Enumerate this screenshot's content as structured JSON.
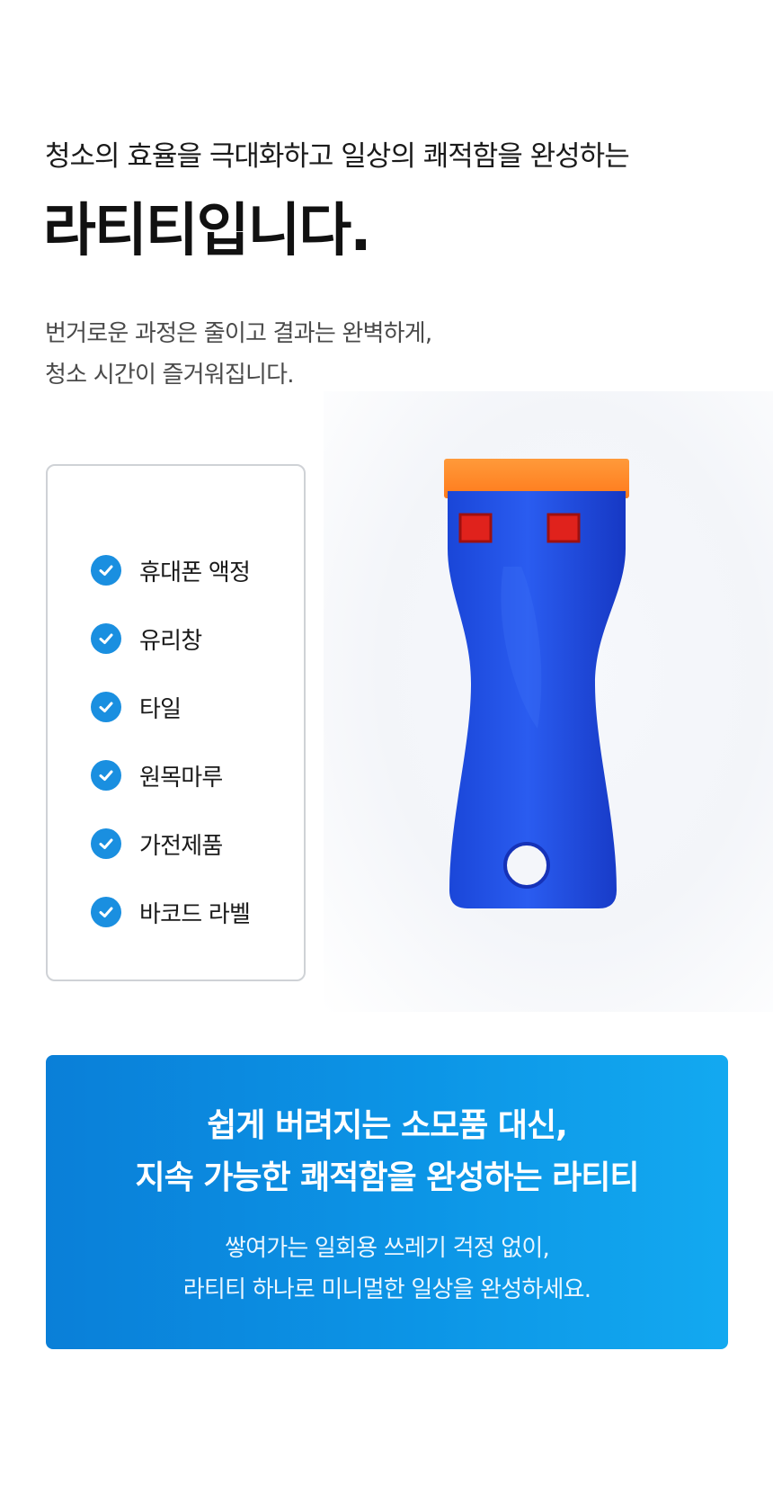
{
  "header": {
    "subtitle": "청소의 효율을 극대화하고 일상의 쾌적함을 완성하는",
    "headline": "라티티입니다."
  },
  "intro": {
    "line1": "번거로운 과정은 줄이고 결과는 완벽하게,",
    "line2": "청소 시간이 즐거워집니다."
  },
  "features": {
    "items": [
      {
        "label": "휴대폰 액정"
      },
      {
        "label": "유리창"
      },
      {
        "label": "타일"
      },
      {
        "label": "원목마루"
      },
      {
        "label": "가전제품"
      },
      {
        "label": "바코드 라벨"
      }
    ],
    "check_icon": "check-circle-icon",
    "accent_color": "#1a8fe0"
  },
  "product_image": {
    "icon": "plastic-razor-scraper-photo",
    "handle_color": "#1f4fe0",
    "blade_color": "#ff8a2a"
  },
  "banner": {
    "title_line1": "쉽게 버려지는 소모품 대신,",
    "title_line2": "지속 가능한 쾌적함을 완성하는 라티티",
    "desc_line1": "쌓여가는 일회용 쓰레기 걱정 없이,",
    "desc_line2": "라티티 하나로 미니멀한 일상을 완성하세요.",
    "gradient_start": "#0a7fd8",
    "gradient_end": "#13a9f0"
  }
}
